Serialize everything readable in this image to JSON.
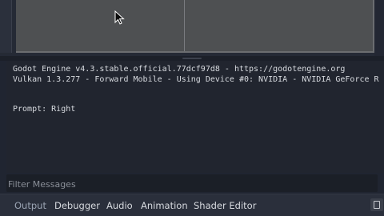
{
  "output": {
    "lines": [
      "Godot Engine v4.3.stable.official.77dcf97d8 - https://godotengine.org",
      "Vulkan 1.3.277 - Forward Mobile - Using Device #0: NVIDIA - NVIDIA GeForce R",
      "",
      "",
      "Prompt: Right"
    ]
  },
  "filter": {
    "placeholder": "Filter Messages"
  },
  "bottom_tabs": [
    {
      "label": "Output",
      "active": true
    },
    {
      "label": "Debugger",
      "active": false
    },
    {
      "label": "Audio",
      "active": false
    },
    {
      "label": "Animation",
      "active": false
    },
    {
      "label": "Shader Editor",
      "active": false
    }
  ],
  "icons": {
    "cursor": "mouse-pointer-icon",
    "pin": "pin-icon"
  },
  "colors": {
    "panel_background": "#21252f",
    "viewport_background": "#4e5052",
    "text": "#d8dbe0",
    "muted_text": "#8a8f98"
  }
}
